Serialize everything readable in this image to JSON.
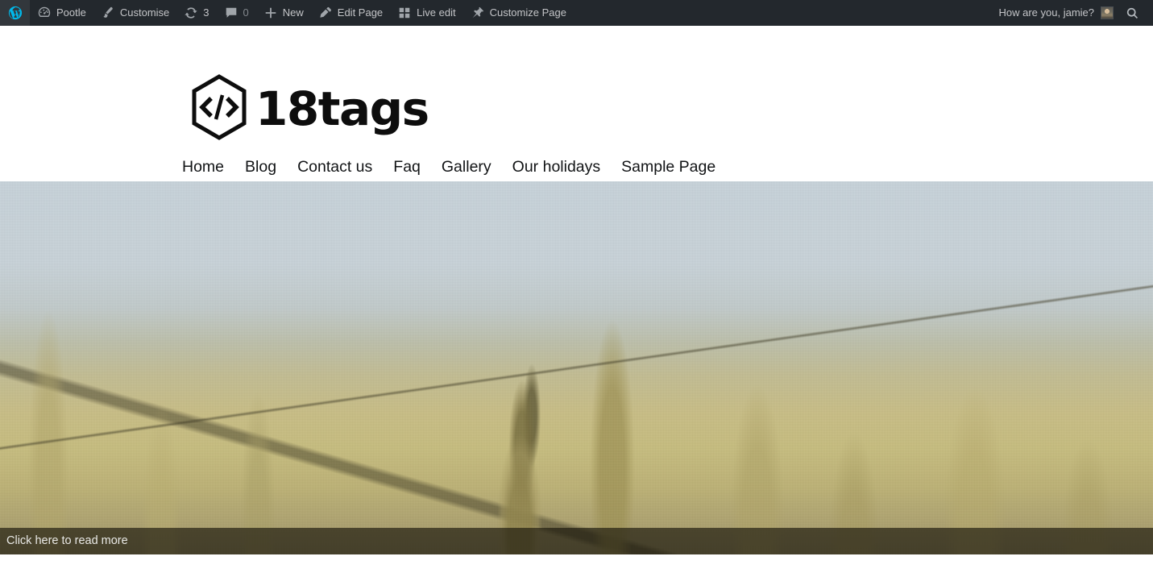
{
  "adminbar": {
    "background": "#23282d",
    "text_color": "#c3c4c7",
    "wp_logo_label": "About WordPress",
    "items": [
      {
        "icon": "wordpress-icon",
        "label": ""
      },
      {
        "icon": "dashboard-icon",
        "label": "Pootle"
      },
      {
        "icon": "paintbrush-icon",
        "label": "Customise"
      },
      {
        "icon": "updates-icon",
        "label": "3"
      },
      {
        "icon": "comment-icon",
        "label": "0"
      },
      {
        "icon": "plus-icon",
        "label": "New"
      },
      {
        "icon": "pencil-icon",
        "label": "Edit Page"
      },
      {
        "icon": "grid-icon",
        "label": "Live edit"
      },
      {
        "icon": "pushpin-icon",
        "label": "Customize Page"
      }
    ],
    "updates_count": "3",
    "comments_count": "0",
    "greeting": "How are you, jamie?",
    "avatar_alt": "jamie avatar",
    "search_icon": "search-icon"
  },
  "site": {
    "logo_mark": "code-hexagon-icon",
    "title": "18tags",
    "nav": [
      {
        "label": "Home"
      },
      {
        "label": "Blog"
      },
      {
        "label": "Contact us"
      },
      {
        "label": "Faq"
      },
      {
        "label": "Gallery"
      },
      {
        "label": "Our holidays"
      },
      {
        "label": "Sample Page"
      }
    ]
  },
  "hero": {
    "image_alt": "Close-up photograph of wheat ears in a sunlit field with a pale blue sky",
    "caption": "Click here to read more",
    "sky_color": "#c8d3da",
    "field_color": "#c7bd7f",
    "caption_overlay": "rgba(24,21,10,0.66)"
  }
}
